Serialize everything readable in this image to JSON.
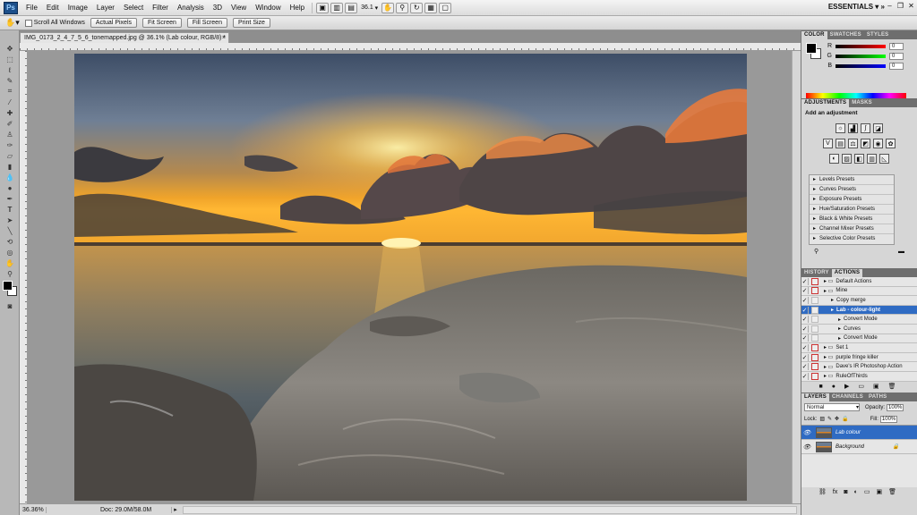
{
  "app_logo": "Ps",
  "menubar": {
    "items": [
      "File",
      "Edit",
      "Image",
      "Layer",
      "Select",
      "Filter",
      "Analysis",
      "3D",
      "View",
      "Window",
      "Help"
    ],
    "zoom_value": "36.1",
    "workspace": "ESSENTIALS"
  },
  "options_bar": {
    "scroll_all": "Scroll All Windows",
    "buttons": [
      "Actual Pixels",
      "Fit Screen",
      "Fill Screen",
      "Print Size"
    ]
  },
  "document": {
    "tab_title": "IMG_0173_2_4_7_5_6_tonemapped.jpg @ 36.1% (Lab colour, RGB/8) *",
    "close": "×",
    "zoom": "36.36%",
    "doc_info": "Doc: 29.0M/58.0M"
  },
  "color_panel": {
    "tabs": [
      "COLOR",
      "SWATCHES",
      "STYLES"
    ],
    "channels": [
      {
        "label": "R",
        "value": "0"
      },
      {
        "label": "G",
        "value": "0"
      },
      {
        "label": "B",
        "value": "0"
      }
    ]
  },
  "adjustments_panel": {
    "tabs": [
      "ADJUSTMENTS",
      "MASKS"
    ],
    "heading": "Add an adjustment",
    "presets": [
      "Levels Presets",
      "Curves Presets",
      "Exposure Presets",
      "Hue/Saturation Presets",
      "Black & White Presets",
      "Channel Mixer Presets",
      "Selective Color Presets"
    ]
  },
  "actions_panel": {
    "tabs": [
      "HISTORY",
      "ACTIONS"
    ],
    "rows": [
      {
        "label": "Default Actions",
        "indent": 0
      },
      {
        "label": "Mine",
        "indent": 0
      },
      {
        "label": "Copy merge",
        "indent": 1
      },
      {
        "label": "Lab - colour-light",
        "indent": 1
      },
      {
        "label": "Convert Mode",
        "indent": 2
      },
      {
        "label": "Curves",
        "indent": 2
      },
      {
        "label": "Convert Mode",
        "indent": 2
      },
      {
        "label": "Set 1",
        "indent": 0
      },
      {
        "label": "purple fringe killer",
        "indent": 0
      },
      {
        "label": "Dave's IR Photoshop Action",
        "indent": 0
      },
      {
        "label": "RuleOfThirds",
        "indent": 0
      }
    ],
    "selected_index": 3
  },
  "layers_panel": {
    "tabs": [
      "LAYERS",
      "CHANNELS",
      "PATHS"
    ],
    "blend_mode": "Normal",
    "opacity_label": "Opacity:",
    "opacity": "100%",
    "lock_label": "Lock:",
    "fill_label": "Fill:",
    "fill": "100%",
    "layers": [
      {
        "name": "Lab colour",
        "selected": true
      },
      {
        "name": "Background",
        "selected": false
      }
    ]
  }
}
